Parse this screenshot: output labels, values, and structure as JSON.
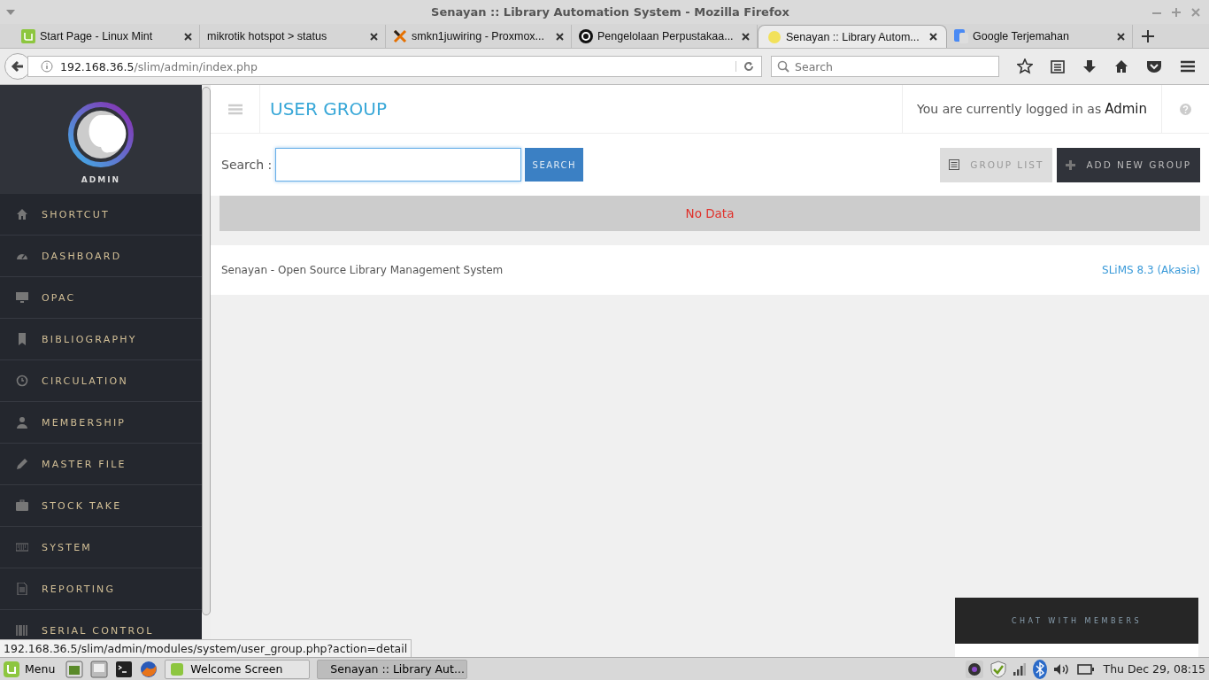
{
  "window": {
    "title": "Senayan :: Library Automation System - Mozilla Firefox"
  },
  "tabs": [
    {
      "label": "Start Page - Linux Mint",
      "selected": false
    },
    {
      "label": "mikrotik hotspot > status",
      "selected": false
    },
    {
      "label": "smkn1juwiring - Proxmox...",
      "selected": false
    },
    {
      "label": "Pengelolaan Perpustakaa...",
      "selected": false
    },
    {
      "label": "Senayan :: Library Autom...",
      "selected": true
    },
    {
      "label": "Google Terjemahan",
      "selected": false
    }
  ],
  "address_bar": {
    "host": "192.168.36.5",
    "path": "/slim/admin/index.php"
  },
  "search_field": {
    "placeholder": "Search"
  },
  "sidebar": {
    "user": "ADMIN",
    "items": [
      {
        "label": "SHORTCUT"
      },
      {
        "label": "DASHBOARD"
      },
      {
        "label": "OPAC"
      },
      {
        "label": "BIBLIOGRAPHY"
      },
      {
        "label": "CIRCULATION"
      },
      {
        "label": "MEMBERSHIP"
      },
      {
        "label": "MASTER FILE"
      },
      {
        "label": "STOCK TAKE"
      },
      {
        "label": "SYSTEM"
      },
      {
        "label": "REPORTING"
      },
      {
        "label": "SERIAL CONTROL"
      }
    ]
  },
  "header": {
    "title": "USER GROUP",
    "login_text": "You are currently logged in as",
    "user": "Admin"
  },
  "search": {
    "label": "Search :",
    "button": "SEARCH"
  },
  "actions": [
    "GROUP LIST",
    "ADD NEW GROUP"
  ],
  "result": "No Data",
  "footer": {
    "left": "Senayan - Open Source Library Management System",
    "right": "SLiMS 8.3 (Akasia)"
  },
  "chat": {
    "title": "CHAT WITH MEMBERS"
  },
  "status_url": "192.168.36.5/slim/admin/modules/system/user_group.php?action=detail",
  "taskbar": {
    "menu": "Menu",
    "windows": [
      {
        "label": "Welcome Screen",
        "selected": false
      },
      {
        "label": "Senayan :: Library Aut...",
        "selected": true
      }
    ],
    "clock": "Thu Dec 29, 08:15"
  }
}
